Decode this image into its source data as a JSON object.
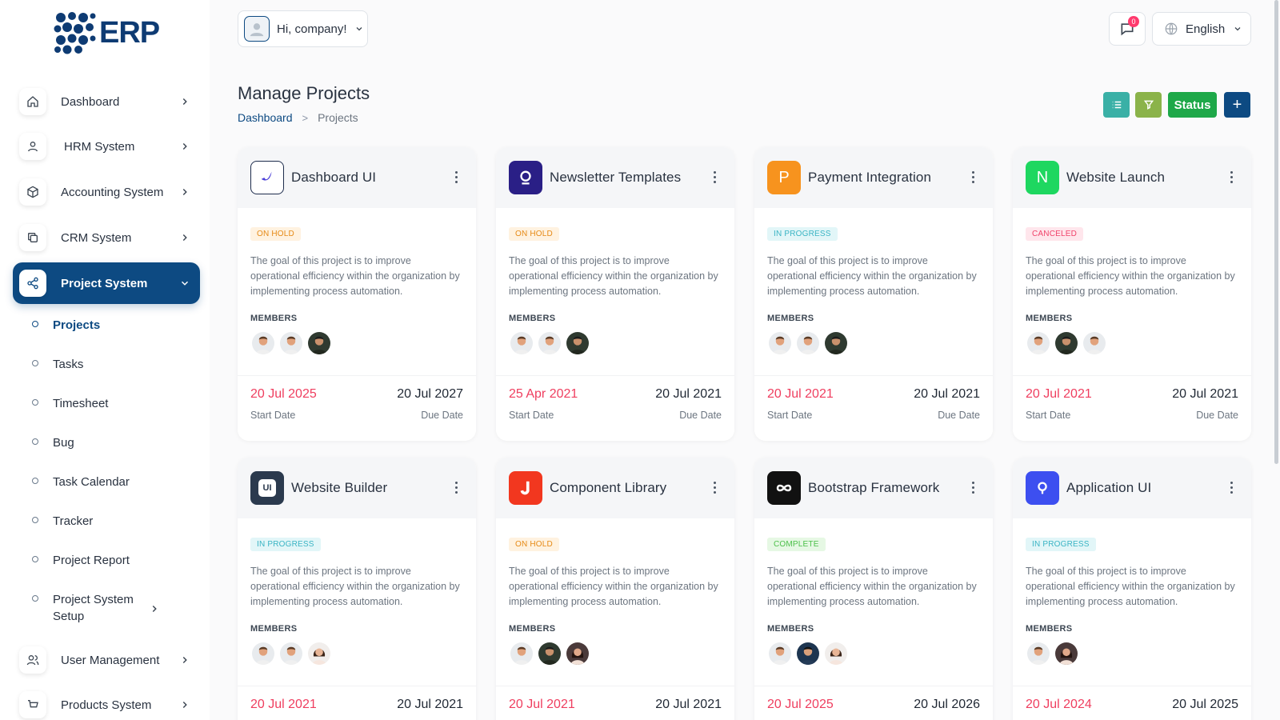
{
  "app": {
    "logo_text": "ERP"
  },
  "sidebar": {
    "items": [
      {
        "label": "Dashboard",
        "icon": "home-icon"
      },
      {
        "label": "HRM System",
        "icon": "user-icon"
      },
      {
        "label": "Accounting System",
        "icon": "box-icon"
      },
      {
        "label": "CRM System",
        "icon": "copy-icon"
      },
      {
        "label": "Project System",
        "icon": "share-icon",
        "active": true
      }
    ],
    "subitems": [
      {
        "label": "Projects",
        "active": true
      },
      {
        "label": "Tasks"
      },
      {
        "label": "Timesheet"
      },
      {
        "label": "Bug"
      },
      {
        "label": "Task Calendar"
      },
      {
        "label": "Tracker"
      },
      {
        "label": "Project Report"
      },
      {
        "label": "Project System Setup"
      }
    ],
    "bottom_items": [
      {
        "label": "User Management",
        "icon": "users-icon"
      },
      {
        "label": "Products System",
        "icon": "cart-icon"
      }
    ]
  },
  "header": {
    "greeting": "Hi, company!",
    "notification_count": "0",
    "language": "English"
  },
  "page": {
    "title": "Manage Projects",
    "breadcrumb": {
      "home": "Dashboard",
      "separator": ">",
      "current": "Projects"
    }
  },
  "toolbar": {
    "status_label": "Status",
    "add_label": "+",
    "colors": {
      "list": "#3ab0a6",
      "filter": "#8bb34a",
      "status": "#1ea849",
      "add": "#0d4a82"
    }
  },
  "labels": {
    "members": "MEMBERS",
    "start": "Start Date",
    "due": "Due Date"
  },
  "projects": [
    {
      "name": "Dashboard UI",
      "status": "ON HOLD",
      "status_class": "st-hold",
      "logo": "dashboard-ui-logo",
      "logo_color": "#ffffff",
      "description": "The goal of this project is to improve operational efficiency within the organization by implementing process automation.",
      "members": [
        "m1",
        "m2",
        "m3"
      ],
      "start": "20 Jul 2025",
      "due": "20 Jul 2027"
    },
    {
      "name": "Newsletter Templates",
      "status": "ON HOLD",
      "status_class": "st-hold",
      "logo": "newsletter-logo",
      "logo_color": "#2a1f86",
      "description": "The goal of this project is to improve operational efficiency within the organization by implementing process automation.",
      "members": [
        "m1",
        "m1",
        "m3"
      ],
      "start": "25 Apr 2021",
      "due": "20 Jul 2021"
    },
    {
      "name": "Payment Integration",
      "status": "IN PROGRESS",
      "status_class": "st-prog",
      "logo": "payment-logo",
      "logo_color": "#f7931e",
      "description": "The goal of this project is to improve operational efficiency within the organization by implementing process automation.",
      "members": [
        "m1",
        "m1",
        "m3"
      ],
      "start": "20 Jul 2021",
      "due": "20 Jul 2021"
    },
    {
      "name": "Website Launch",
      "status": "CANCELED",
      "status_class": "st-cancel",
      "logo": "website-launch-logo",
      "logo_color": "#1ed760",
      "description": "The goal of this project is to improve operational efficiency within the organization by implementing process automation.",
      "members": [
        "m1",
        "m3",
        "m1"
      ],
      "start": "20 Jul 2021",
      "due": "20 Jul 2021"
    },
    {
      "name": "Website Builder",
      "status": "IN PROGRESS",
      "status_class": "st-prog",
      "logo": "website-builder-logo",
      "logo_color": "#2b3a4e",
      "description": "The goal of this project is to improve operational efficiency within the organization by implementing process automation.",
      "members": [
        "m1",
        "m1",
        "f1"
      ],
      "start": "20 Jul 2021",
      "due": "20 Jul 2021"
    },
    {
      "name": "Component Library",
      "status": "ON HOLD",
      "status_class": "st-hold",
      "logo": "component-library-logo",
      "logo_color": "#f2371f",
      "description": "The goal of this project is to improve operational efficiency within the organization by implementing process automation.",
      "members": [
        "m1",
        "m3",
        "f2"
      ],
      "start": "20 Jul 2021",
      "due": "20 Jul 2021"
    },
    {
      "name": "Bootstrap Framework",
      "status": "COMPLETE",
      "status_class": "st-complete",
      "logo": "bootstrap-logo",
      "logo_color": "#111111",
      "description": "The goal of this project is to improve operational efficiency within the organization by implementing process automation.",
      "members": [
        "m1",
        "m4",
        "f1"
      ],
      "start": "20 Jul 2025",
      "due": "20 Jul 2026"
    },
    {
      "name": "Application UI",
      "status": "IN PROGRESS",
      "status_class": "st-prog",
      "logo": "application-ui-logo",
      "logo_color": "#3d4ff0",
      "description": "The goal of this project is to improve operational efficiency within the organization by implementing process automation.",
      "members": [
        "m1",
        "f2"
      ],
      "start": "20 Jul 2024",
      "due": "20 Jul 2025"
    }
  ]
}
